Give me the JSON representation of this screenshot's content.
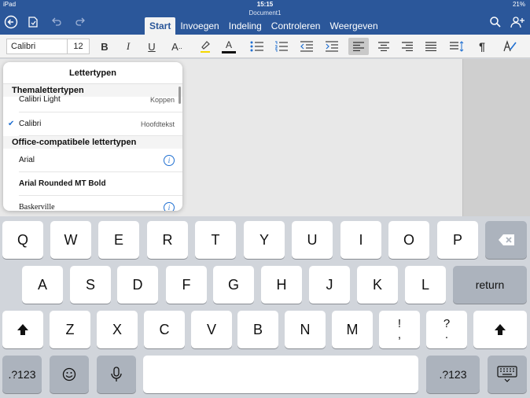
{
  "status": {
    "carrier": "iPad",
    "time": "15:15",
    "battery": "21%"
  },
  "document": {
    "title": "Document1"
  },
  "ribbon": {
    "tabs": [
      {
        "label": "Start",
        "active": true
      },
      {
        "label": "Invoegen",
        "active": false
      },
      {
        "label": "Indeling",
        "active": false
      },
      {
        "label": "Controleren",
        "active": false
      },
      {
        "label": "Weergeven",
        "active": false
      }
    ]
  },
  "toolbar": {
    "font_name": "Calibri",
    "font_size": "12",
    "bold": "B",
    "italic": "I",
    "underline": "U",
    "effects": "A",
    "font_color_glyph": "A",
    "paragraph_mark": "¶"
  },
  "font_popover": {
    "title": "Lettertypen",
    "theme_section": "Themalettertypen",
    "theme_fonts": [
      {
        "name": "Calibri Light",
        "role": "Koppen"
      },
      {
        "name": "Calibri",
        "role": "Hoofdtekst",
        "checked": true
      }
    ],
    "office_section": "Office-compatibele lettertypen",
    "office_fonts": [
      {
        "name": "Arial"
      },
      {
        "name": "Arial Rounded MT Bold"
      },
      {
        "name": "Baskerville"
      }
    ],
    "info_glyph": "i"
  },
  "keyboard": {
    "row1": [
      "Q",
      "W",
      "E",
      "R",
      "T",
      "Y",
      "U",
      "I",
      "O",
      "P"
    ],
    "row2": [
      "A",
      "S",
      "D",
      "F",
      "G",
      "H",
      "J",
      "K",
      "L"
    ],
    "row3": [
      "Z",
      "X",
      "C",
      "V",
      "B",
      "N",
      "M"
    ],
    "row3_punct": [
      {
        "top": "!",
        "bottom": ","
      },
      {
        "top": "?",
        "bottom": "."
      }
    ],
    "return_label": "return",
    "numbers_label": ".?123"
  },
  "colors": {
    "ribbon_blue": "#2b579a",
    "check_blue": "#1f6fd1"
  }
}
